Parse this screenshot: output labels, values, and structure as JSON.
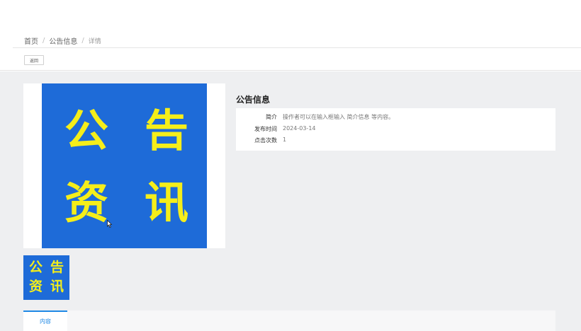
{
  "breadcrumb": {
    "home": "首页",
    "section": "公告信息",
    "current": "详情",
    "separator": "/"
  },
  "toolbar": {
    "back_label": "返回"
  },
  "image": {
    "chars": [
      "公",
      "告",
      "资",
      "讯"
    ],
    "background_color": "#1e6bd8",
    "text_color": "#f5ee1a"
  },
  "thumbnail": {
    "chars": [
      "公",
      "告",
      "资",
      "讯"
    ]
  },
  "info": {
    "title": "公告信息",
    "rows": [
      {
        "label": "简介",
        "value": "操作者可以在输入框输入 简介信息 等内容。"
      },
      {
        "label": "发布时间",
        "value": "2024-03-14"
      },
      {
        "label": "点击次数",
        "value": "1"
      }
    ]
  },
  "tabs": [
    {
      "label": "内容",
      "active": true
    }
  ],
  "colors": {
    "accent": "#1e88e5",
    "page_bg": "#eeeff1"
  }
}
